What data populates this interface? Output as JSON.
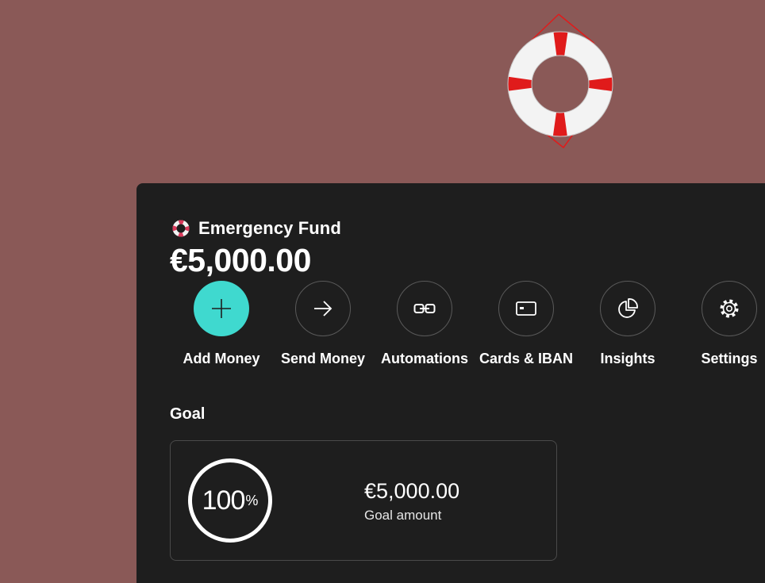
{
  "pot": {
    "name": "Emergency Fund",
    "icon": "lifebuoy-icon",
    "balance": "€5,000.00"
  },
  "actions": [
    {
      "label": "Add Money",
      "icon": "plus-icon",
      "accent": "#3fd9cf"
    },
    {
      "label": "Send Money",
      "icon": "arrow-right-icon"
    },
    {
      "label": "Automations",
      "icon": "link-icon"
    },
    {
      "label": "Cards & IBAN",
      "icon": "card-icon"
    },
    {
      "label": "Insights",
      "icon": "pie-chart-icon"
    },
    {
      "label": "Settings",
      "icon": "gear-icon"
    }
  ],
  "goal": {
    "heading": "Goal",
    "progress_value": "100",
    "progress_unit": "%",
    "progress_fraction": 1.0,
    "amount": "€5,000.00",
    "caption": "Goal amount"
  },
  "colors": {
    "background": "#8a5957",
    "panel": "#1e1e1e",
    "accent": "#3fd9cf",
    "lifebuoy_red": "#e01b1b"
  }
}
